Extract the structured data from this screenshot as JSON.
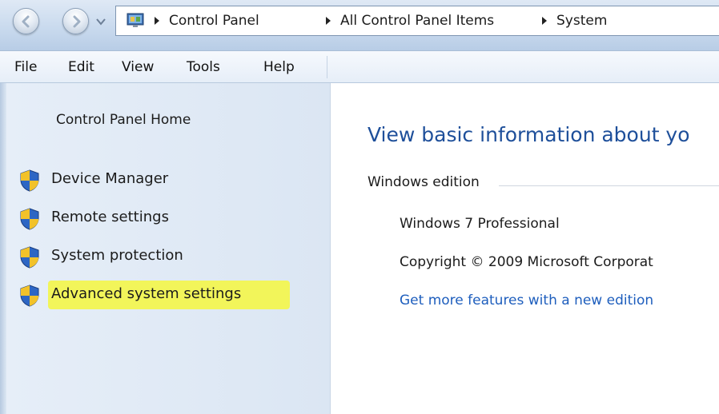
{
  "address": {
    "crumbs": [
      "Control Panel",
      "All Control Panel Items",
      "System"
    ]
  },
  "menu": [
    "File",
    "Edit",
    "View",
    "Tools",
    "Help"
  ],
  "sidebar": {
    "home_label": "Control Panel Home",
    "tasks": [
      {
        "label": "Device Manager",
        "icon": "uac-shield-icon"
      },
      {
        "label": "Remote settings",
        "icon": "uac-shield-icon"
      },
      {
        "label": "System protection",
        "icon": "uac-shield-icon"
      },
      {
        "label": "Advanced system settings",
        "icon": "uac-shield-icon",
        "highlighted": true
      }
    ],
    "highlight_color": "#f2f55a"
  },
  "main": {
    "heading": "View basic information about yo",
    "edition_section_title": "Windows edition",
    "edition_name": "Windows 7 Professional",
    "copyright": "Copyright © 2009 Microsoft Corporat",
    "more_features_link": "Get more features with a new edition"
  },
  "colors": {
    "heading": "#1e4f9a",
    "link": "#1e5ebd"
  }
}
